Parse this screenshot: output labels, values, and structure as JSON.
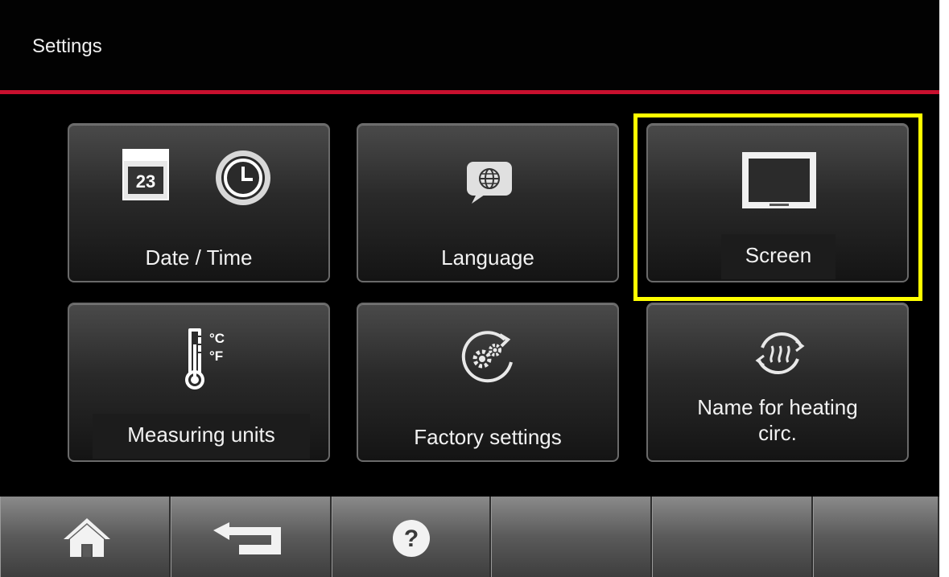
{
  "header": {
    "title": "Settings"
  },
  "tiles": [
    {
      "label": "Date / Time",
      "calendar_day": "23"
    },
    {
      "label": "Language"
    },
    {
      "label": "Screen"
    },
    {
      "label": "Measuring units",
      "units": [
        "°C",
        "°F"
      ]
    },
    {
      "label": "Factory settings"
    },
    {
      "label": "Name for heating circ."
    }
  ],
  "bottom_bar": {
    "buttons": [
      "home-icon",
      "back-icon",
      "help-icon"
    ],
    "help_symbol": "?"
  },
  "highlight": {
    "color": "#ffff00",
    "target": "Screen"
  },
  "colors": {
    "accent_line": "#c8102e",
    "background": "#000000"
  }
}
